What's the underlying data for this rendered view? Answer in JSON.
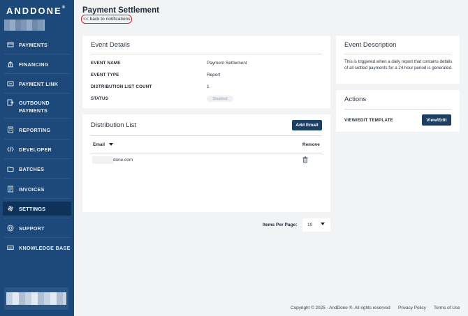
{
  "app": {
    "logo": "ANDDONE",
    "logo_mark": "®"
  },
  "sidebar": {
    "items": [
      {
        "label": "PAYMENTS",
        "icon": "payments-icon"
      },
      {
        "label": "FINANCING",
        "icon": "bank-icon"
      },
      {
        "label": "PAYMENT LINK",
        "icon": "link-icon"
      },
      {
        "label": "OUTBOUND PAYMENTS",
        "icon": "outbound-icon"
      },
      {
        "label": "REPORTING",
        "icon": "report-icon"
      },
      {
        "label": "DEVELOPER",
        "icon": "code-icon"
      },
      {
        "label": "BATCHES",
        "icon": "folder-icon"
      },
      {
        "label": "INVOICES",
        "icon": "invoice-icon"
      },
      {
        "label": "SETTINGS",
        "icon": "gear-icon",
        "active": true
      },
      {
        "label": "SUPPORT",
        "icon": "support-icon"
      },
      {
        "label": "KNOWLEDGE BASE",
        "icon": "keyboard-icon"
      }
    ]
  },
  "header": {
    "title": "Payment Settlement",
    "back_link": "<< back to notifications"
  },
  "event_details": {
    "title": "Event Details",
    "rows": [
      {
        "label": "EVENT NAME",
        "value": "Payment Settlement"
      },
      {
        "label": "EVENT TYPE",
        "value": "Report"
      },
      {
        "label": "DISTRIBUTION LIST COUNT",
        "value": "1"
      },
      {
        "label": "STATUS",
        "value": "Disabled"
      }
    ]
  },
  "distribution_list": {
    "title": "Distribution List",
    "add_button": "Add Email",
    "columns": {
      "email": "Email",
      "remove": "Remove"
    },
    "rows": [
      {
        "email": "done.com"
      }
    ]
  },
  "event_description": {
    "title": "Event Description",
    "text": "This is triggered when a daily report that contains details of all settled payments for a 24 hour period is generated."
  },
  "actions": {
    "title": "Actions",
    "row_label": "VIEW/EDIT TEMPLATE",
    "button": "View/Edit"
  },
  "pagination": {
    "label": "Items Per Page:",
    "value": "10"
  },
  "footer": {
    "copyright": "Copyright © 2025 - AndDone ®. All rights reserved",
    "privacy": "Privacy Policy",
    "terms": "Terms of Use"
  },
  "colors": {
    "sidebar": "#1c4979",
    "sidebar_active": "#0f3358",
    "button": "#1c3f63",
    "highlight": "#d0242b"
  }
}
